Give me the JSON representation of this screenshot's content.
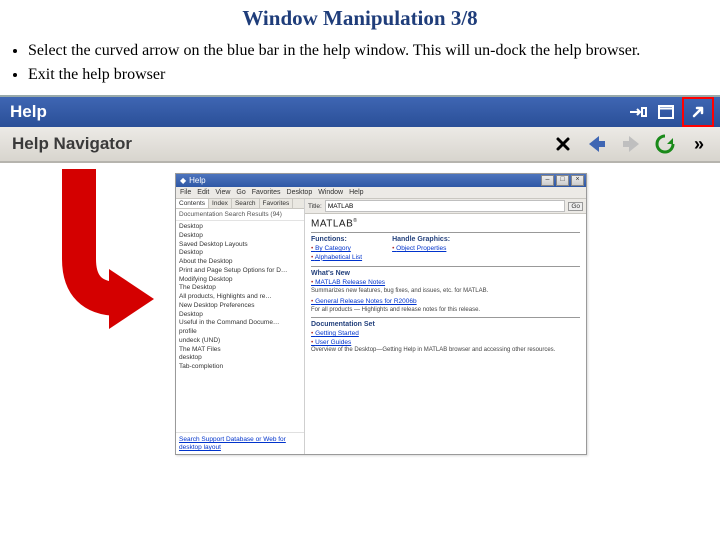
{
  "title": "Window Manipulation 3/8",
  "bullets": [
    "Select the curved arrow on the blue bar in the help window. This will un-dock the help browser.",
    "Exit the help browser"
  ],
  "help_bar": {
    "label": "Help",
    "icons": {
      "dock_toggle": "dock-toggle-icon",
      "maximize": "maximize-icon",
      "undock": "undock-arrow-icon"
    }
  },
  "nav_bar": {
    "label": "Help Navigator",
    "icons": {
      "close": "close-icon",
      "back": "back-arrow-icon",
      "forward": "forward-arrow-icon",
      "refresh": "refresh-icon",
      "more": "more-icon"
    }
  },
  "undocked_window": {
    "title": "Help",
    "menu": [
      "File",
      "Edit",
      "View",
      "Go",
      "Favorites",
      "Desktop",
      "Window",
      "Help"
    ],
    "left_pane": {
      "tabs": [
        "Contents",
        "Index",
        "Search",
        "Favorites"
      ],
      "active_tab": "Contents",
      "section_label": "Documentation Search Results (94)",
      "tree_items": [
        "Desktop",
        "Desktop",
        "Saved Desktop Layouts",
        "Desktop",
        "About the Desktop",
        "Print and Page Setup Options for D…",
        "Modifying Desktop",
        "The Desktop",
        "All products, Highlights and re…",
        "New Desktop Preferences",
        "Desktop",
        "Useful in the Command Docume…",
        "profile",
        "undeck (UND)",
        "The MAT Files",
        "desktop",
        "Tab-completion"
      ],
      "footer_link": "Search Support Database or Web for desktop layout"
    },
    "right_pane": {
      "addr_label": "Title:",
      "addr_value": "MATLAB",
      "brand": "MATLAB",
      "columns": [
        {
          "heading": "Functions:",
          "links": [
            "By Category",
            "Alphabetical List"
          ]
        },
        {
          "heading": "Handle Graphics:",
          "links": [
            "Object Properties"
          ]
        }
      ],
      "whats_new": {
        "heading": "What's New",
        "items": [
          {
            "link": "MATLAB Release Notes",
            "desc": "Summarizes new features, bug fixes, and issues, etc. for MATLAB."
          },
          {
            "link": "General Release Notes for R2006b",
            "desc": "For all products — Highlights and release notes for this release."
          }
        ]
      },
      "doc_set": {
        "heading": "Documentation Set",
        "links": [
          "Getting Started",
          "User Guides"
        ],
        "desc": "Overview of the Desktop—Getting Help in MATLAB browser and accessing other resources."
      }
    }
  }
}
